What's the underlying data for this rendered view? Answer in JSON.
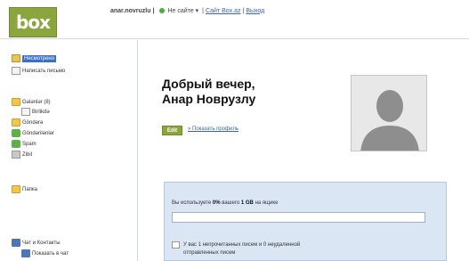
{
  "header": {
    "logo_text": "box",
    "user": "anar.novruzlu |",
    "status": "Не сайте",
    "links": [
      "Сайт Box.az",
      "Выход"
    ]
  },
  "sidebar": {
    "items": [
      {
        "label": "Несмотрено",
        "icon": "mailbox-icon",
        "active": true
      },
      {
        "label": "Написать письмо",
        "icon": "compose-icon"
      },
      {
        "label": "Gələnlər (8)",
        "icon": "folder-icon"
      },
      {
        "label": "Birlikdə",
        "icon": "folder-icon"
      },
      {
        "label": "Göndərə",
        "icon": "folder-icon"
      },
      {
        "label": "Göndərilənlər",
        "icon": "green-icon"
      },
      {
        "label": "Spam",
        "icon": "green-icon"
      },
      {
        "label": "Zibil",
        "icon": "trash-icon"
      },
      {
        "label": "Папка",
        "icon": "folder-icon"
      },
      {
        "label": "Чат и Контакты",
        "icon": "chat-icon"
      },
      {
        "label": "Показать в чат",
        "icon": "chat-icon"
      }
    ]
  },
  "main": {
    "greeting_line1": "Добрый вечер,",
    "greeting_line2": "Анар Новрузлу",
    "edit_button": "Edit",
    "edit_link": "» Показать профиль",
    "quota": {
      "prefix": "Вы используете",
      "percent": "0%",
      "middle": "вашего",
      "size": "1 GB",
      "suffix": "на ящике",
      "used_fraction": 0.0
    },
    "unread_line1": "У вас 1 непрочитанных писем и 0 неудаленной",
    "unread_line2": "отправленных писем"
  },
  "colors": {
    "brand_green": "#8aa63d",
    "link_blue": "#3a62b8",
    "panel_blue": "#dbe6f5"
  }
}
